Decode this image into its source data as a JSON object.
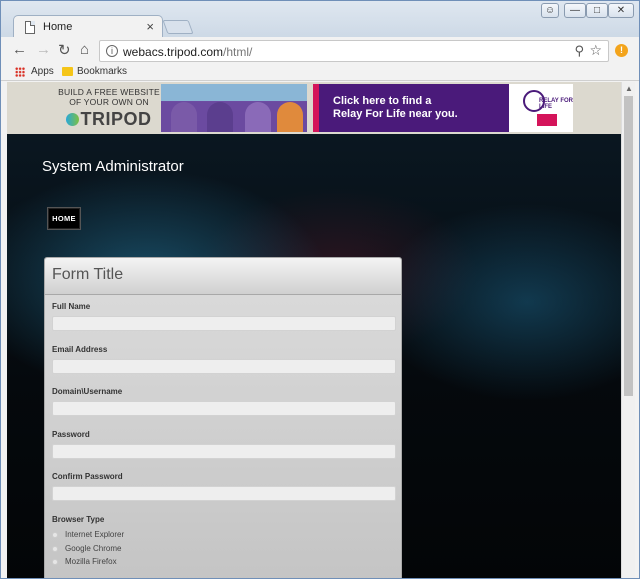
{
  "browser": {
    "tab_title": "Home",
    "tab_close": "×",
    "url_host": "webacs.tripod.com",
    "url_path": "/html/",
    "bookmarks": [
      {
        "label": "Apps"
      },
      {
        "label": "Bookmarks"
      }
    ]
  },
  "ad": {
    "left_line1": "BUILD A FREE WEBSITE",
    "left_line2": "OF YOUR OWN ON",
    "left_logo": "TRIPOD",
    "cta_line1": "Click here to find a",
    "cta_line2": "Relay For Life near you.",
    "relay_logo": "RELAY FOR LIFE"
  },
  "site": {
    "title": "System Administrator",
    "nav": [
      {
        "label": "HOME"
      }
    ]
  },
  "form": {
    "title": "Form Title",
    "fields": [
      {
        "label": "Full Name",
        "value": ""
      },
      {
        "label": "Email Address",
        "value": ""
      },
      {
        "label": "Domain\\Username",
        "value": ""
      },
      {
        "label": "Password",
        "value": ""
      },
      {
        "label": "Confirm Password",
        "value": ""
      }
    ],
    "browser_type": {
      "label": "Browser Type",
      "options": [
        {
          "label": "Internet Explorer"
        },
        {
          "label": "Google Chrome"
        },
        {
          "label": "Mozilla Firefox"
        }
      ]
    }
  },
  "colors": {
    "ad_purple": "#4a1a7a",
    "ad_accent": "#d4145a",
    "extension_badge": "#f3a41c"
  }
}
